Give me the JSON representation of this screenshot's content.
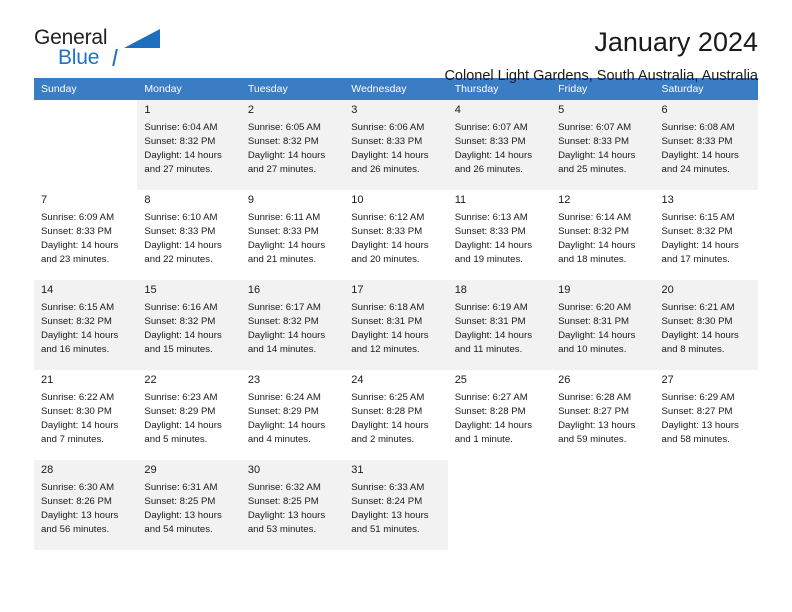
{
  "brand": {
    "word_one": "General",
    "word_two": "Blue",
    "triangle_icon": "triangle-logo-icon",
    "accent_color": "#1f6fbf"
  },
  "header": {
    "title": "January 2024",
    "location": "Colonel Light Gardens, South Australia, Australia"
  },
  "calendar": {
    "header_bg": "#3b7dc4",
    "alt_row_bg": "#f2f2f2",
    "weekday_headers": [
      "Sunday",
      "Monday",
      "Tuesday",
      "Wednesday",
      "Thursday",
      "Friday",
      "Saturday"
    ],
    "weeks": [
      [
        {
          "day": "",
          "info": ""
        },
        {
          "day": "1",
          "info": "Sunrise: 6:04 AM\nSunset: 8:32 PM\nDaylight: 14 hours and 27 minutes."
        },
        {
          "day": "2",
          "info": "Sunrise: 6:05 AM\nSunset: 8:32 PM\nDaylight: 14 hours and 27 minutes."
        },
        {
          "day": "3",
          "info": "Sunrise: 6:06 AM\nSunset: 8:33 PM\nDaylight: 14 hours and 26 minutes."
        },
        {
          "day": "4",
          "info": "Sunrise: 6:07 AM\nSunset: 8:33 PM\nDaylight: 14 hours and 26 minutes."
        },
        {
          "day": "5",
          "info": "Sunrise: 6:07 AM\nSunset: 8:33 PM\nDaylight: 14 hours and 25 minutes."
        },
        {
          "day": "6",
          "info": "Sunrise: 6:08 AM\nSunset: 8:33 PM\nDaylight: 14 hours and 24 minutes."
        }
      ],
      [
        {
          "day": "7",
          "info": "Sunrise: 6:09 AM\nSunset: 8:33 PM\nDaylight: 14 hours and 23 minutes."
        },
        {
          "day": "8",
          "info": "Sunrise: 6:10 AM\nSunset: 8:33 PM\nDaylight: 14 hours and 22 minutes."
        },
        {
          "day": "9",
          "info": "Sunrise: 6:11 AM\nSunset: 8:33 PM\nDaylight: 14 hours and 21 minutes."
        },
        {
          "day": "10",
          "info": "Sunrise: 6:12 AM\nSunset: 8:33 PM\nDaylight: 14 hours and 20 minutes."
        },
        {
          "day": "11",
          "info": "Sunrise: 6:13 AM\nSunset: 8:33 PM\nDaylight: 14 hours and 19 minutes."
        },
        {
          "day": "12",
          "info": "Sunrise: 6:14 AM\nSunset: 8:32 PM\nDaylight: 14 hours and 18 minutes."
        },
        {
          "day": "13",
          "info": "Sunrise: 6:15 AM\nSunset: 8:32 PM\nDaylight: 14 hours and 17 minutes."
        }
      ],
      [
        {
          "day": "14",
          "info": "Sunrise: 6:15 AM\nSunset: 8:32 PM\nDaylight: 14 hours and 16 minutes."
        },
        {
          "day": "15",
          "info": "Sunrise: 6:16 AM\nSunset: 8:32 PM\nDaylight: 14 hours and 15 minutes."
        },
        {
          "day": "16",
          "info": "Sunrise: 6:17 AM\nSunset: 8:32 PM\nDaylight: 14 hours and 14 minutes."
        },
        {
          "day": "17",
          "info": "Sunrise: 6:18 AM\nSunset: 8:31 PM\nDaylight: 14 hours and 12 minutes."
        },
        {
          "day": "18",
          "info": "Sunrise: 6:19 AM\nSunset: 8:31 PM\nDaylight: 14 hours and 11 minutes."
        },
        {
          "day": "19",
          "info": "Sunrise: 6:20 AM\nSunset: 8:31 PM\nDaylight: 14 hours and 10 minutes."
        },
        {
          "day": "20",
          "info": "Sunrise: 6:21 AM\nSunset: 8:30 PM\nDaylight: 14 hours and 8 minutes."
        }
      ],
      [
        {
          "day": "21",
          "info": "Sunrise: 6:22 AM\nSunset: 8:30 PM\nDaylight: 14 hours and 7 minutes."
        },
        {
          "day": "22",
          "info": "Sunrise: 6:23 AM\nSunset: 8:29 PM\nDaylight: 14 hours and 5 minutes."
        },
        {
          "day": "23",
          "info": "Sunrise: 6:24 AM\nSunset: 8:29 PM\nDaylight: 14 hours and 4 minutes."
        },
        {
          "day": "24",
          "info": "Sunrise: 6:25 AM\nSunset: 8:28 PM\nDaylight: 14 hours and 2 minutes."
        },
        {
          "day": "25",
          "info": "Sunrise: 6:27 AM\nSunset: 8:28 PM\nDaylight: 14 hours and 1 minute."
        },
        {
          "day": "26",
          "info": "Sunrise: 6:28 AM\nSunset: 8:27 PM\nDaylight: 13 hours and 59 minutes."
        },
        {
          "day": "27",
          "info": "Sunrise: 6:29 AM\nSunset: 8:27 PM\nDaylight: 13 hours and 58 minutes."
        }
      ],
      [
        {
          "day": "28",
          "info": "Sunrise: 6:30 AM\nSunset: 8:26 PM\nDaylight: 13 hours and 56 minutes."
        },
        {
          "day": "29",
          "info": "Sunrise: 6:31 AM\nSunset: 8:25 PM\nDaylight: 13 hours and 54 minutes."
        },
        {
          "day": "30",
          "info": "Sunrise: 6:32 AM\nSunset: 8:25 PM\nDaylight: 13 hours and 53 minutes."
        },
        {
          "day": "31",
          "info": "Sunrise: 6:33 AM\nSunset: 8:24 PM\nDaylight: 13 hours and 51 minutes."
        },
        {
          "day": "",
          "info": ""
        },
        {
          "day": "",
          "info": ""
        },
        {
          "day": "",
          "info": ""
        }
      ]
    ]
  }
}
